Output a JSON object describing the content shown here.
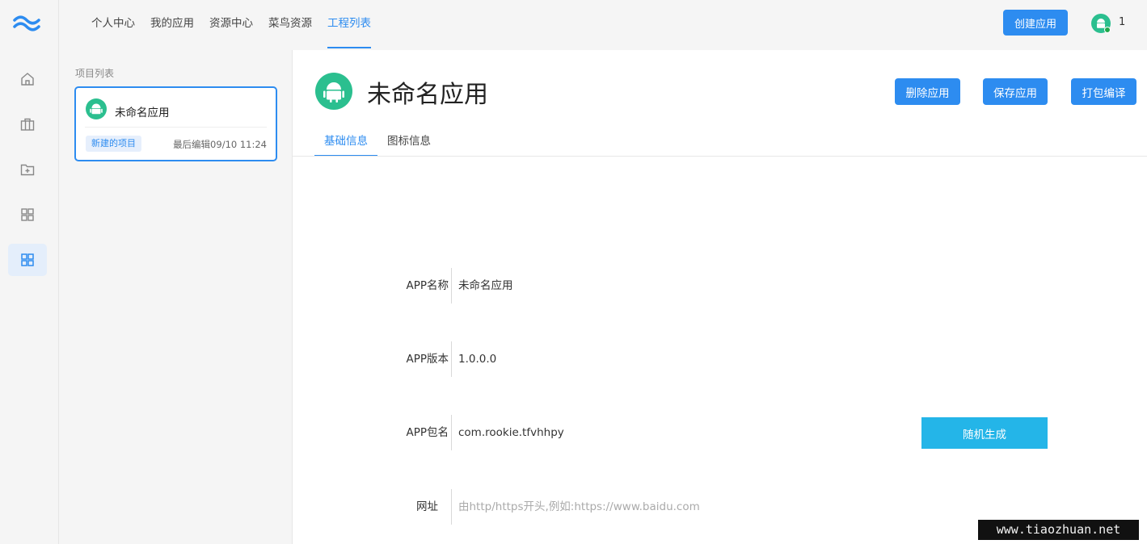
{
  "rail": {
    "logo": "wave-logo-icon",
    "items": [
      {
        "icon": "home-icon"
      },
      {
        "icon": "briefcase-icon"
      },
      {
        "icon": "folder-add-icon"
      },
      {
        "icon": "grid-icon"
      },
      {
        "icon": "grid-icon",
        "active": true
      }
    ]
  },
  "topnav": {
    "tabs": [
      {
        "label": "个人中心"
      },
      {
        "label": "我的应用"
      },
      {
        "label": "资源中心"
      },
      {
        "label": "菜鸟资源"
      },
      {
        "label": "工程列表",
        "active": true
      }
    ],
    "create_label": "创建应用",
    "user_count": "1"
  },
  "project_panel": {
    "title": "项目列表",
    "projects": [
      {
        "name": "未命名应用",
        "badge": "新建的项目",
        "time": "最后编辑09/10 11:24"
      }
    ]
  },
  "main": {
    "app_title": "未命名应用",
    "actions": {
      "delete": "删除应用",
      "save": "保存应用",
      "build": "打包编译"
    },
    "tabs": [
      {
        "label": "基础信息",
        "active": true
      },
      {
        "label": "图标信息"
      }
    ],
    "form": {
      "app_name_label": "APP名称",
      "app_name": "未命名应用",
      "app_version_label": "APP版本",
      "app_version": "1.0.0.0",
      "app_package_label": "APP包名",
      "app_package": "com.rookie.tfvhhpy",
      "random_label": "随机生成",
      "url_label": "网址",
      "url_placeholder": "由http/https开头,例如:https://www.baidu.com"
    }
  },
  "watermark": "www.tiaozhuan.net",
  "colors": {
    "accent": "#2d8cf0",
    "random_button": "#24b5e8",
    "android_green": "#2bbf8f"
  }
}
